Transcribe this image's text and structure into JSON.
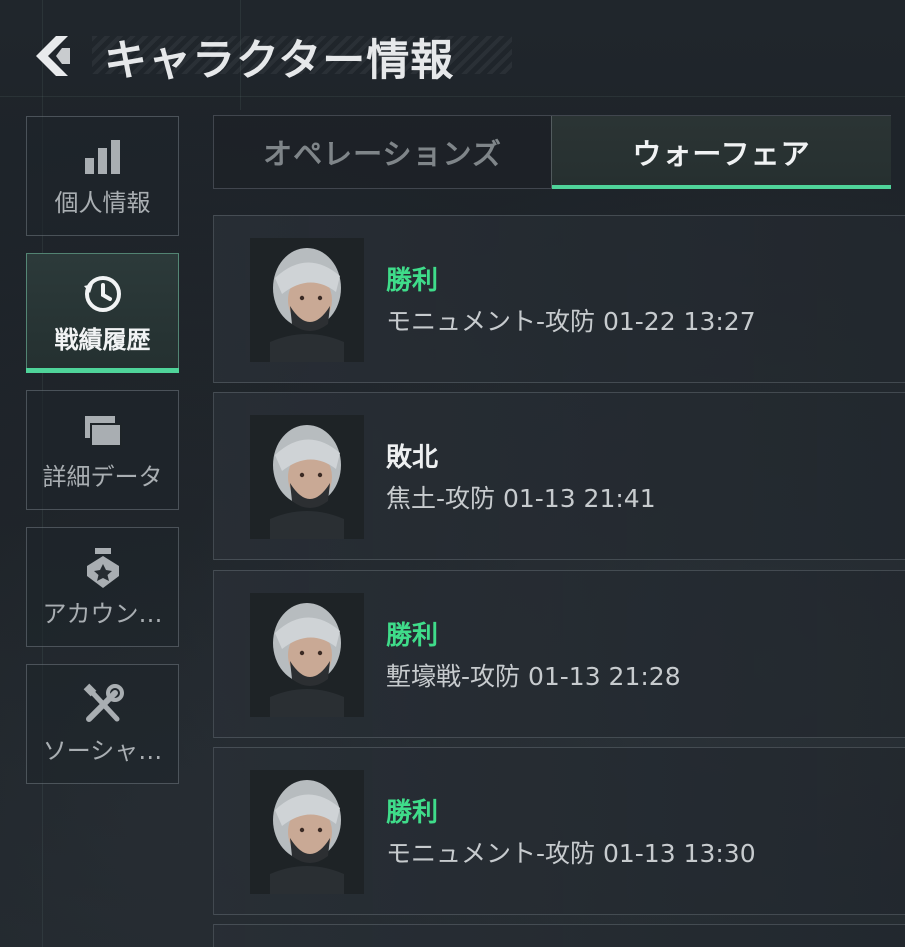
{
  "header": {
    "title": "キャラクター情報"
  },
  "sidebar": {
    "items": [
      {
        "label": "個人情報",
        "icon": "bar-chart-icon",
        "active": false
      },
      {
        "label": "戦績履歴",
        "icon": "history-clock-icon",
        "active": true
      },
      {
        "label": "詳細データ",
        "icon": "folders-icon",
        "active": false
      },
      {
        "label": "アカウン…",
        "icon": "medal-icon",
        "active": false
      },
      {
        "label": "ソーシャ…",
        "icon": "tools-icon",
        "active": false
      }
    ]
  },
  "tabs": [
    {
      "label": "オペレーションズ",
      "active": false
    },
    {
      "label": "ウォーフェア",
      "active": true
    }
  ],
  "records": [
    {
      "result": "勝利",
      "outcome": "win",
      "detail": "モニュメント-攻防 01-22 13:27"
    },
    {
      "result": "敗北",
      "outcome": "lose",
      "detail": "焦土-攻防 01-13 21:41"
    },
    {
      "result": "勝利",
      "outcome": "win",
      "detail": "塹壕戦-攻防 01-13 21:28"
    },
    {
      "result": "勝利",
      "outcome": "win",
      "detail": "モニュメント-攻防 01-13 13:30"
    }
  ],
  "colors": {
    "accent": "#4fd49a",
    "win": "#3fdc8a",
    "lose": "#eef0f1",
    "background": "#1b2025"
  }
}
